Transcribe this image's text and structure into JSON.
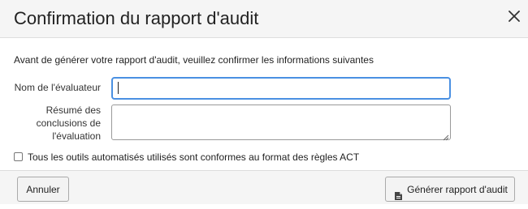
{
  "dialog": {
    "title": "Confirmation du rapport d'audit",
    "close_icon": "close-icon"
  },
  "body": {
    "intro": "Avant de générer votre rapport d'audit, veuillez confirmer les informations suivantes",
    "fields": {
      "evaluator_name": {
        "label": "Nom de l'évaluateur",
        "value": ""
      },
      "summary": {
        "label_lines": [
          "Résumé des",
          "conclusions de",
          "l'évaluation"
        ],
        "value": ""
      }
    },
    "checkbox": {
      "label": "Tous les outils automatisés utilisés sont conformes au format des règles ACT",
      "checked": false
    }
  },
  "footer": {
    "cancel_label": "Annuler",
    "generate_label": "Générer rapport d'audit",
    "generate_icon": "document-icon"
  },
  "colors": {
    "header_bg": "#f5f5f5",
    "focus_border": "#4a90e2",
    "button_bg": "#f3f3f3"
  }
}
